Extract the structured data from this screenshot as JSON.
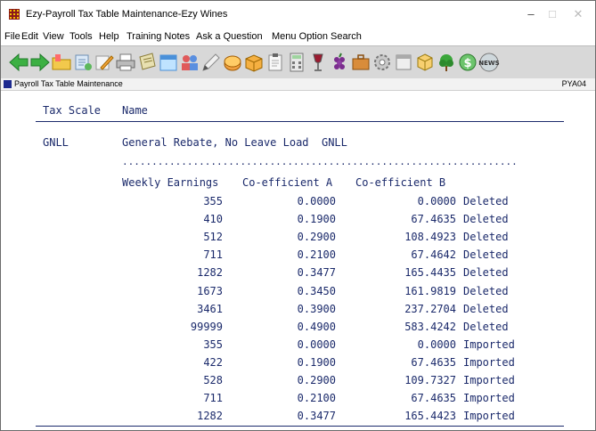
{
  "window": {
    "title": "Ezy-Payroll Tax Table Maintenance-Ezy Wines",
    "minimize_glyph": "–",
    "maximize_glyph": "□",
    "close_glyph": "✕"
  },
  "menu": [
    "File",
    "Edit",
    "View",
    "Tools",
    "Help",
    "Training Notes",
    "Ask a Question",
    "Menu Option Search"
  ],
  "toolbar_icons": [
    "back-arrow-icon",
    "forward-arrow-icon",
    "open-folder-icon",
    "open-document-icon",
    "edit-pen-icon",
    "printer-icon",
    "notepad-icon",
    "calendar-icon",
    "users-icon",
    "pencil-icon",
    "coin-icon",
    "package-icon",
    "clipboard-icon",
    "calculator-icon",
    "wine-glass-icon",
    "grapes-icon",
    "briefcase-icon",
    "gear-icon",
    "window-icon",
    "cube-icon",
    "tree-icon",
    "dollar-icon",
    "news-icon"
  ],
  "news_icon_text": "NEWS",
  "form": {
    "title": "Payroll Tax Table Maintenance",
    "code": "PYA04"
  },
  "headers": {
    "tax_scale": "Tax Scale",
    "name": "Name"
  },
  "scale": {
    "code": "GNLL",
    "name": "General Rebate, No Leave Load  GNLL"
  },
  "dots": "...................................................................",
  "table": {
    "columns": [
      "Weekly Earnings",
      "Co-efficient A",
      "Co-efficient B"
    ],
    "rows": [
      {
        "earnings": "355",
        "a": "0.0000",
        "b": "0.0000",
        "status": "Deleted"
      },
      {
        "earnings": "410",
        "a": "0.1900",
        "b": "67.4635",
        "status": "Deleted"
      },
      {
        "earnings": "512",
        "a": "0.2900",
        "b": "108.4923",
        "status": "Deleted"
      },
      {
        "earnings": "711",
        "a": "0.2100",
        "b": "67.4642",
        "status": "Deleted"
      },
      {
        "earnings": "1282",
        "a": "0.3477",
        "b": "165.4435",
        "status": "Deleted"
      },
      {
        "earnings": "1673",
        "a": "0.3450",
        "b": "161.9819",
        "status": "Deleted"
      },
      {
        "earnings": "3461",
        "a": "0.3900",
        "b": "237.2704",
        "status": "Deleted"
      },
      {
        "earnings": "99999",
        "a": "0.4900",
        "b": "583.4242",
        "status": "Deleted"
      },
      {
        "earnings": "355",
        "a": "0.0000",
        "b": "0.0000",
        "status": "Imported"
      },
      {
        "earnings": "422",
        "a": "0.1900",
        "b": "67.4635",
        "status": "Imported"
      },
      {
        "earnings": "528",
        "a": "0.2900",
        "b": "109.7327",
        "status": "Imported"
      },
      {
        "earnings": "711",
        "a": "0.2100",
        "b": "67.4635",
        "status": "Imported"
      },
      {
        "earnings": "1282",
        "a": "0.3477",
        "b": "165.4423",
        "status": "Imported"
      }
    ]
  }
}
